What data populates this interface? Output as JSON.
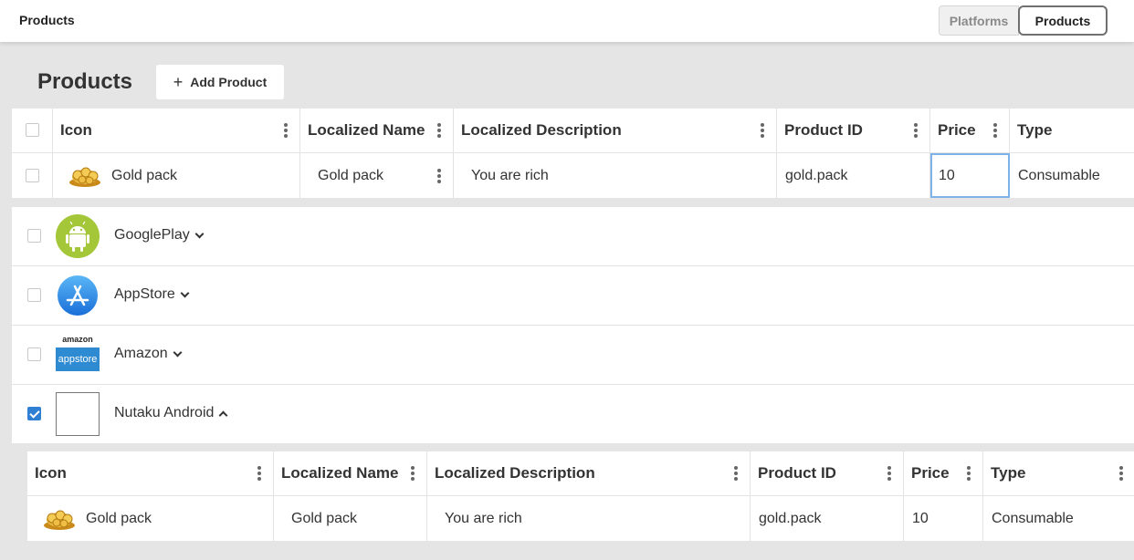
{
  "topbar": {
    "title": "Products",
    "tabs": [
      "Platforms",
      "Products"
    ],
    "active_tab": "Products"
  },
  "page": {
    "title": "Products",
    "add_button": "Add Product",
    "add_icon": "+"
  },
  "columns": [
    "Icon",
    "Localized Name",
    "Localized Description",
    "Product ID",
    "Price",
    "Type"
  ],
  "products": [
    {
      "icon": "gold-coins-icon",
      "name": "Gold pack",
      "localized_name": "Gold pack",
      "localized_description": "You are rich",
      "product_id": "gold.pack",
      "price": "10",
      "type": "Consumable"
    }
  ],
  "platforms": [
    {
      "name": "GooglePlay",
      "icon": "android-icon",
      "checked": false,
      "expanded": false
    },
    {
      "name": "AppStore",
      "icon": "appstore-icon",
      "checked": false,
      "expanded": false
    },
    {
      "name": "Amazon",
      "icon": "amazon-appstore-icon",
      "checked": false,
      "expanded": false,
      "icon_text_top": "amazon",
      "icon_text_bottom": "appstore"
    },
    {
      "name": "Nutaku Android",
      "icon": "blank-icon",
      "checked": true,
      "expanded": true
    }
  ],
  "nutaku_products": [
    {
      "icon": "gold-coins-icon",
      "name": "Gold pack",
      "localized_name": "Gold pack",
      "localized_description": "You are rich",
      "product_id": "gold.pack",
      "price": "10",
      "type": "Consumable"
    }
  ],
  "colors": {
    "background": "#e5e5e5",
    "accent": "#2f7fd3",
    "android_green": "#a4c639",
    "appstore_blue": "#1a86e8",
    "amazon_blue": "#2e8ad1"
  }
}
